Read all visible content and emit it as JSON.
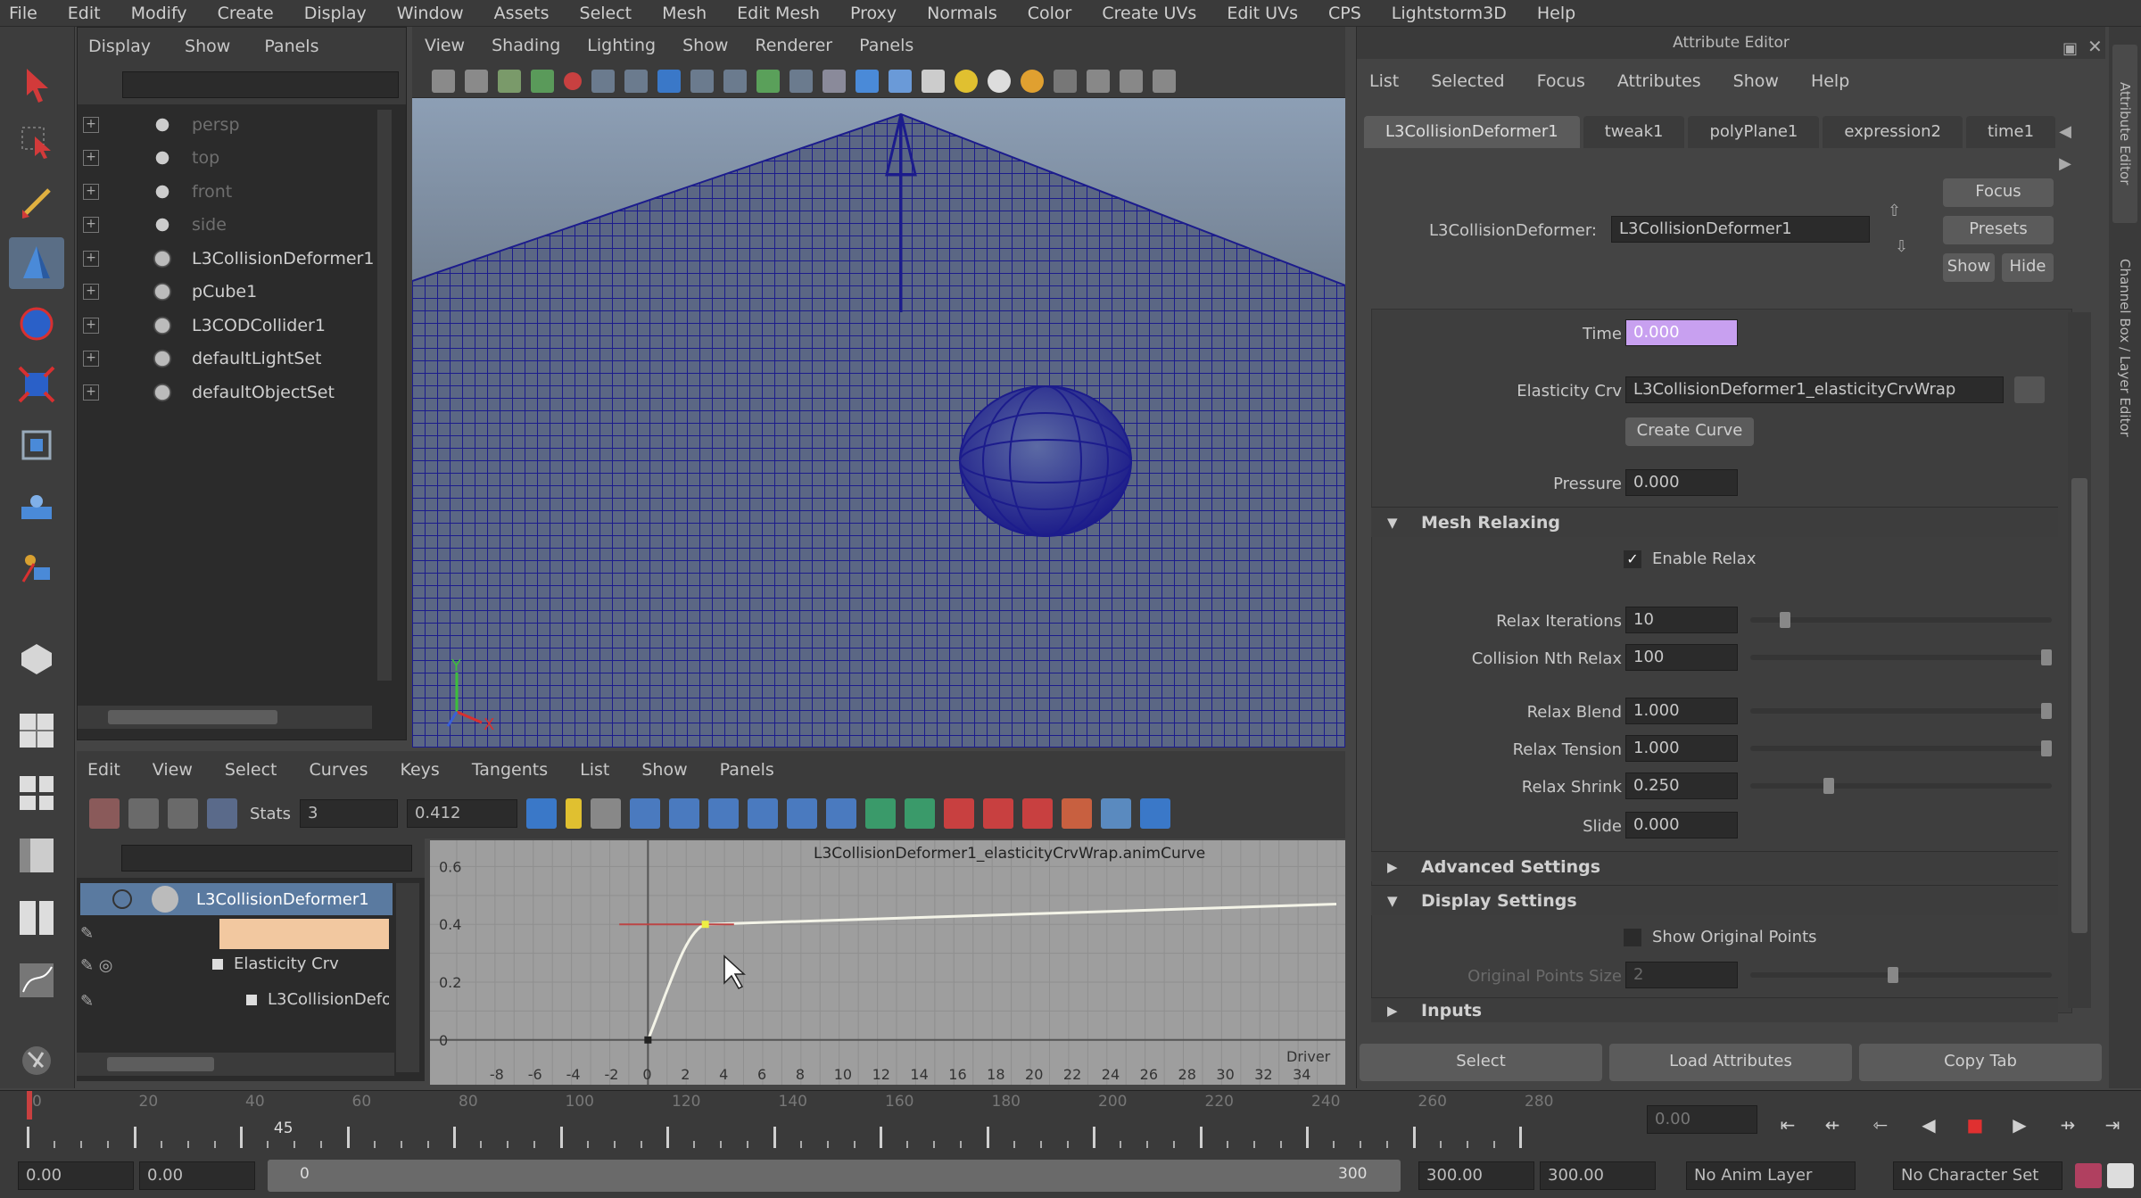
{
  "menubar": [
    "File",
    "Edit",
    "Modify",
    "Create",
    "Display",
    "Window",
    "Assets",
    "Select",
    "Mesh",
    "Edit Mesh",
    "Proxy",
    "Normals",
    "Color",
    "Create UVs",
    "Edit UVs",
    "CPS",
    "Lightstorm3D",
    "Help"
  ],
  "outliner": {
    "menu": [
      "Display",
      "Show",
      "Panels"
    ],
    "items": [
      {
        "label": "persp",
        "dim": true
      },
      {
        "label": "top",
        "dim": true
      },
      {
        "label": "front",
        "dim": true
      },
      {
        "label": "side",
        "dim": true
      },
      {
        "label": "L3CollisionDeformer1",
        "dim": false
      },
      {
        "label": "pCube1",
        "dim": false
      },
      {
        "label": "L3CODCollider1",
        "dim": false
      },
      {
        "label": "defaultLightSet",
        "dim": false
      },
      {
        "label": "defaultObjectSet",
        "dim": false
      }
    ]
  },
  "viewport": {
    "menu": [
      "View",
      "Shading",
      "Lighting",
      "Show",
      "Renderer",
      "Panels"
    ],
    "axis": {
      "y": "Y",
      "x": "X"
    },
    "colors": {
      "mesh": "#1c1c8c",
      "bg_top": "#8d9fb5",
      "bg_bottom": "#33373d"
    }
  },
  "graph_editor": {
    "menu": [
      "Edit",
      "View",
      "Select",
      "Curves",
      "Keys",
      "Tangents",
      "List",
      "Show",
      "Panels"
    ],
    "stats_label": "Stats",
    "stats_frame": "3",
    "stats_value": "0.412",
    "outliner_items": [
      {
        "label": "L3CollisionDeformer1",
        "selected": true
      },
      {
        "label": "Elasticity Crv",
        "selected": false
      },
      {
        "label": "L3CollisionDefo",
        "selected": false
      }
    ],
    "curve_title": "L3CollisionDeformer1_elasticityCrvWrap.animCurve",
    "y_ticks": [
      "0.6",
      "0.4",
      "0.2",
      "0"
    ],
    "x_ticks": [
      "-8",
      "-6",
      "-4",
      "-2",
      "0",
      "2",
      "4",
      "6",
      "8",
      "10",
      "12",
      "14",
      "16",
      "18",
      "20",
      "22",
      "24",
      "26",
      "28",
      "30",
      "32",
      "34"
    ],
    "x_axis_label": "Driver"
  },
  "attribute_editor": {
    "title": "Attribute Editor",
    "menu": [
      "List",
      "Selected",
      "Focus",
      "Attributes",
      "Show",
      "Help"
    ],
    "tabs": [
      "L3CollisionDeformer1",
      "tweak1",
      "polyPlane1",
      "expression2",
      "time1"
    ],
    "active_tab": 0,
    "node_label": "L3CollisionDeformer:",
    "node_value": "L3CollisionDeformer1",
    "buttons": {
      "focus": "Focus",
      "presets": "Presets",
      "show": "Show",
      "hide": "Hide"
    },
    "time_label": "Time",
    "time_value": "0.000",
    "elasticity_label": "Elasticity Crv",
    "elasticity_value": "L3CollisionDeformer1_elasticityCrvWrap",
    "create_curve": "Create Curve",
    "pressure_label": "Pressure",
    "pressure_value": "0.000",
    "sections": {
      "mesh_relaxing": "Mesh Relaxing",
      "advanced": "Advanced Settings",
      "display": "Display Settings",
      "inputs": "Inputs"
    },
    "enable_relax": "Enable Relax",
    "relax": [
      {
        "label": "Relax Iterations",
        "value": "10",
        "level": 0.1
      },
      {
        "label": "Collision Nth Relax",
        "value": "100",
        "level": 1.0
      },
      {
        "label": "Relax Blend",
        "value": "1.000",
        "level": 1.0
      },
      {
        "label": "Relax Tension",
        "value": "1.000",
        "level": 1.0
      },
      {
        "label": "Relax Shrink",
        "value": "0.250",
        "level": 0.25
      }
    ],
    "slide_label": "Slide",
    "slide_value": "0.000",
    "show_original_points": "Show Original Points",
    "original_points_size": "Original Points Size",
    "original_points_value": "2",
    "bottom_buttons": [
      "Select",
      "Load Attributes",
      "Copy Tab"
    ],
    "side_tabs": [
      "Attribute Editor",
      "Channel Box / Layer Editor"
    ]
  },
  "timeline": {
    "ticks": [
      "0",
      "20",
      "40",
      "60",
      "80",
      "100",
      "120",
      "140",
      "160",
      "180",
      "200",
      "220",
      "240",
      "260",
      "280"
    ],
    "current_frame": "45",
    "current_value": "0.00",
    "range_start": "0.00",
    "range_start2": "0.00",
    "range_slider_start": "0",
    "range_slider_end": "300",
    "range_end": "300.00",
    "range_end2": "300.00",
    "anim_layer": "No Anim Layer",
    "character_set": "No Character Set"
  }
}
